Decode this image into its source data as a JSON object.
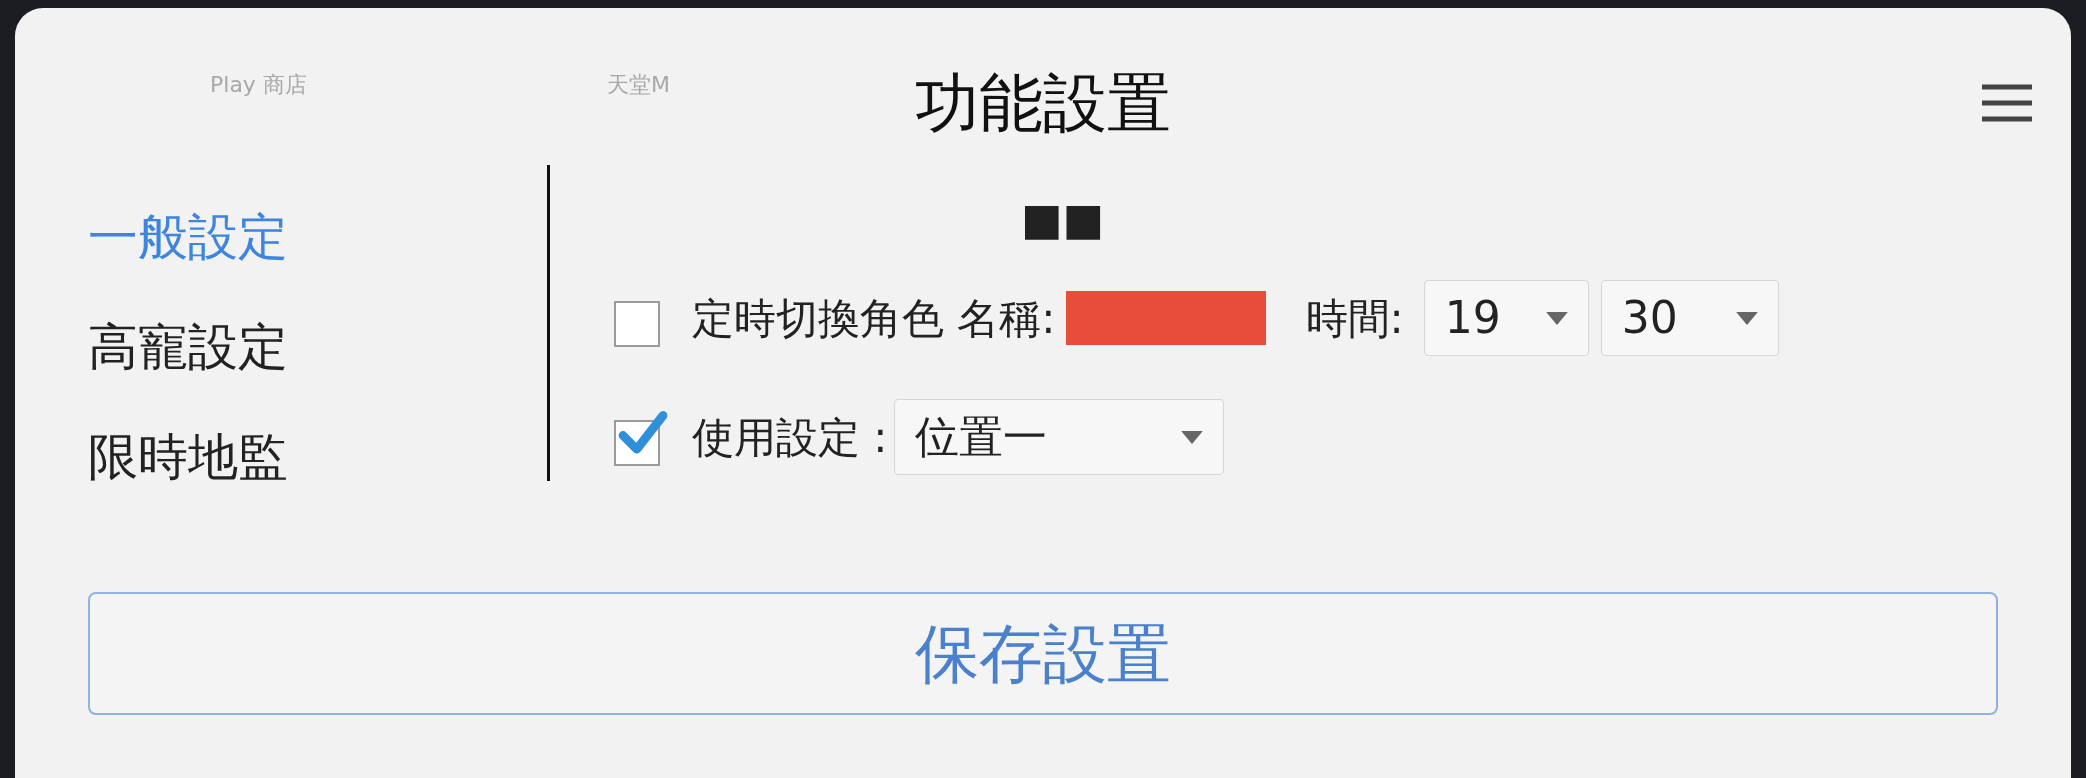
{
  "background_labels": [
    "Play 商店",
    "天堂M"
  ],
  "dialog": {
    "title": "功能設置",
    "sidebar": {
      "items": [
        {
          "label": "一般設定",
          "selected": true
        },
        {
          "label": "高寵設定",
          "selected": false
        },
        {
          "label": "限時地監",
          "selected": false
        }
      ]
    },
    "panel": {
      "heading": "■■",
      "timed_switch": {
        "checked": false,
        "label": "定時切換角色 名稱:",
        "time_label": "時間:",
        "hour": "19",
        "minute": "30"
      },
      "use_setting": {
        "checked": true,
        "label": "使用設定 :",
        "value": "位置一"
      }
    },
    "save_button": "保存設置"
  }
}
